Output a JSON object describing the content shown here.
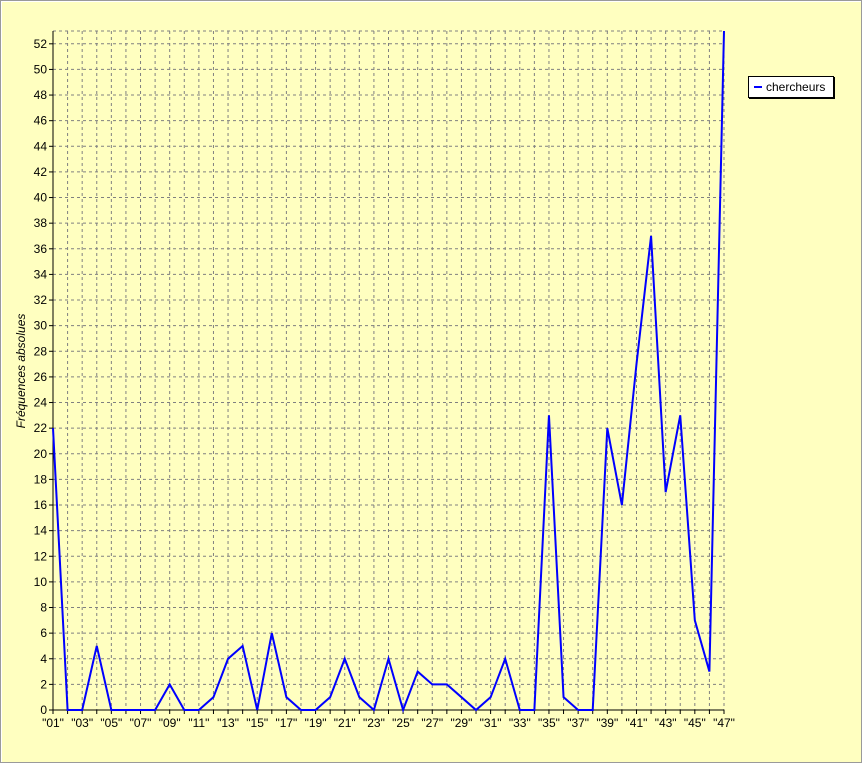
{
  "chart_data": {
    "type": "line",
    "title": "",
    "xlabel": "",
    "ylabel": "Fréquences absolues",
    "ylim": [
      0,
      53
    ],
    "yticks": [
      0,
      2,
      4,
      6,
      8,
      10,
      12,
      14,
      16,
      18,
      20,
      22,
      24,
      26,
      28,
      30,
      32,
      34,
      36,
      38,
      40,
      42,
      44,
      46,
      48,
      50,
      52
    ],
    "grid": true,
    "legend_position": "right",
    "categories": [
      "\"01\"",
      "\"02\"",
      "\"03\"",
      "\"04\"",
      "\"05\"",
      "\"06\"",
      "\"07\"",
      "\"08\"",
      "\"09\"",
      "\"10\"",
      "\"11\"",
      "\"12\"",
      "\"13\"",
      "\"14\"",
      "\"15\"",
      "\"16\"",
      "\"17\"",
      "\"18\"",
      "\"19\"",
      "\"20\"",
      "\"21\"",
      "\"22\"",
      "\"23\"",
      "\"24\"",
      "\"25\"",
      "\"26\"",
      "\"27\"",
      "\"28\"",
      "\"29\"",
      "\"30\"",
      "\"31\"",
      "\"32\"",
      "\"33\"",
      "\"34\"",
      "\"35\"",
      "\"36\"",
      "\"37\"",
      "\"38\"",
      "\"39\"",
      "\"40\"",
      "\"41\"",
      "\"42\"",
      "\"43\"",
      "\"44\"",
      "\"45\"",
      "\"46\"",
      "\"47\""
    ],
    "x_tick_labels": [
      "\"01\"",
      "\"03\"",
      "\"05\"",
      "\"07\"",
      "\"09\"",
      "\"11\"",
      "\"13\"",
      "\"15\"",
      "\"17\"",
      "\"19\"",
      "\"21\"",
      "\"23\"",
      "\"25\"",
      "\"27\"",
      "\"29\"",
      "\"31\"",
      "\"33\"",
      "\"35\"",
      "\"37\"",
      "\"39\"",
      "\"41\"",
      "\"43\"",
      "\"45\"",
      "\"47\""
    ],
    "series": [
      {
        "name": "chercheurs",
        "color": "#0000ff",
        "values": [
          22,
          0,
          0,
          5,
          0,
          0,
          0,
          0,
          2,
          0,
          0,
          1,
          4,
          5,
          0,
          6,
          1,
          0,
          0,
          1,
          4,
          1,
          0,
          4,
          0,
          3,
          2,
          2,
          1,
          0,
          1,
          4,
          0,
          0,
          23,
          1,
          0,
          0,
          22,
          16,
          27,
          37,
          17,
          23,
          7,
          3,
          53
        ]
      }
    ]
  },
  "colors": {
    "background": "#ffffc0",
    "grid": "#808080",
    "axis": "#000000",
    "line": "#0000ff"
  }
}
